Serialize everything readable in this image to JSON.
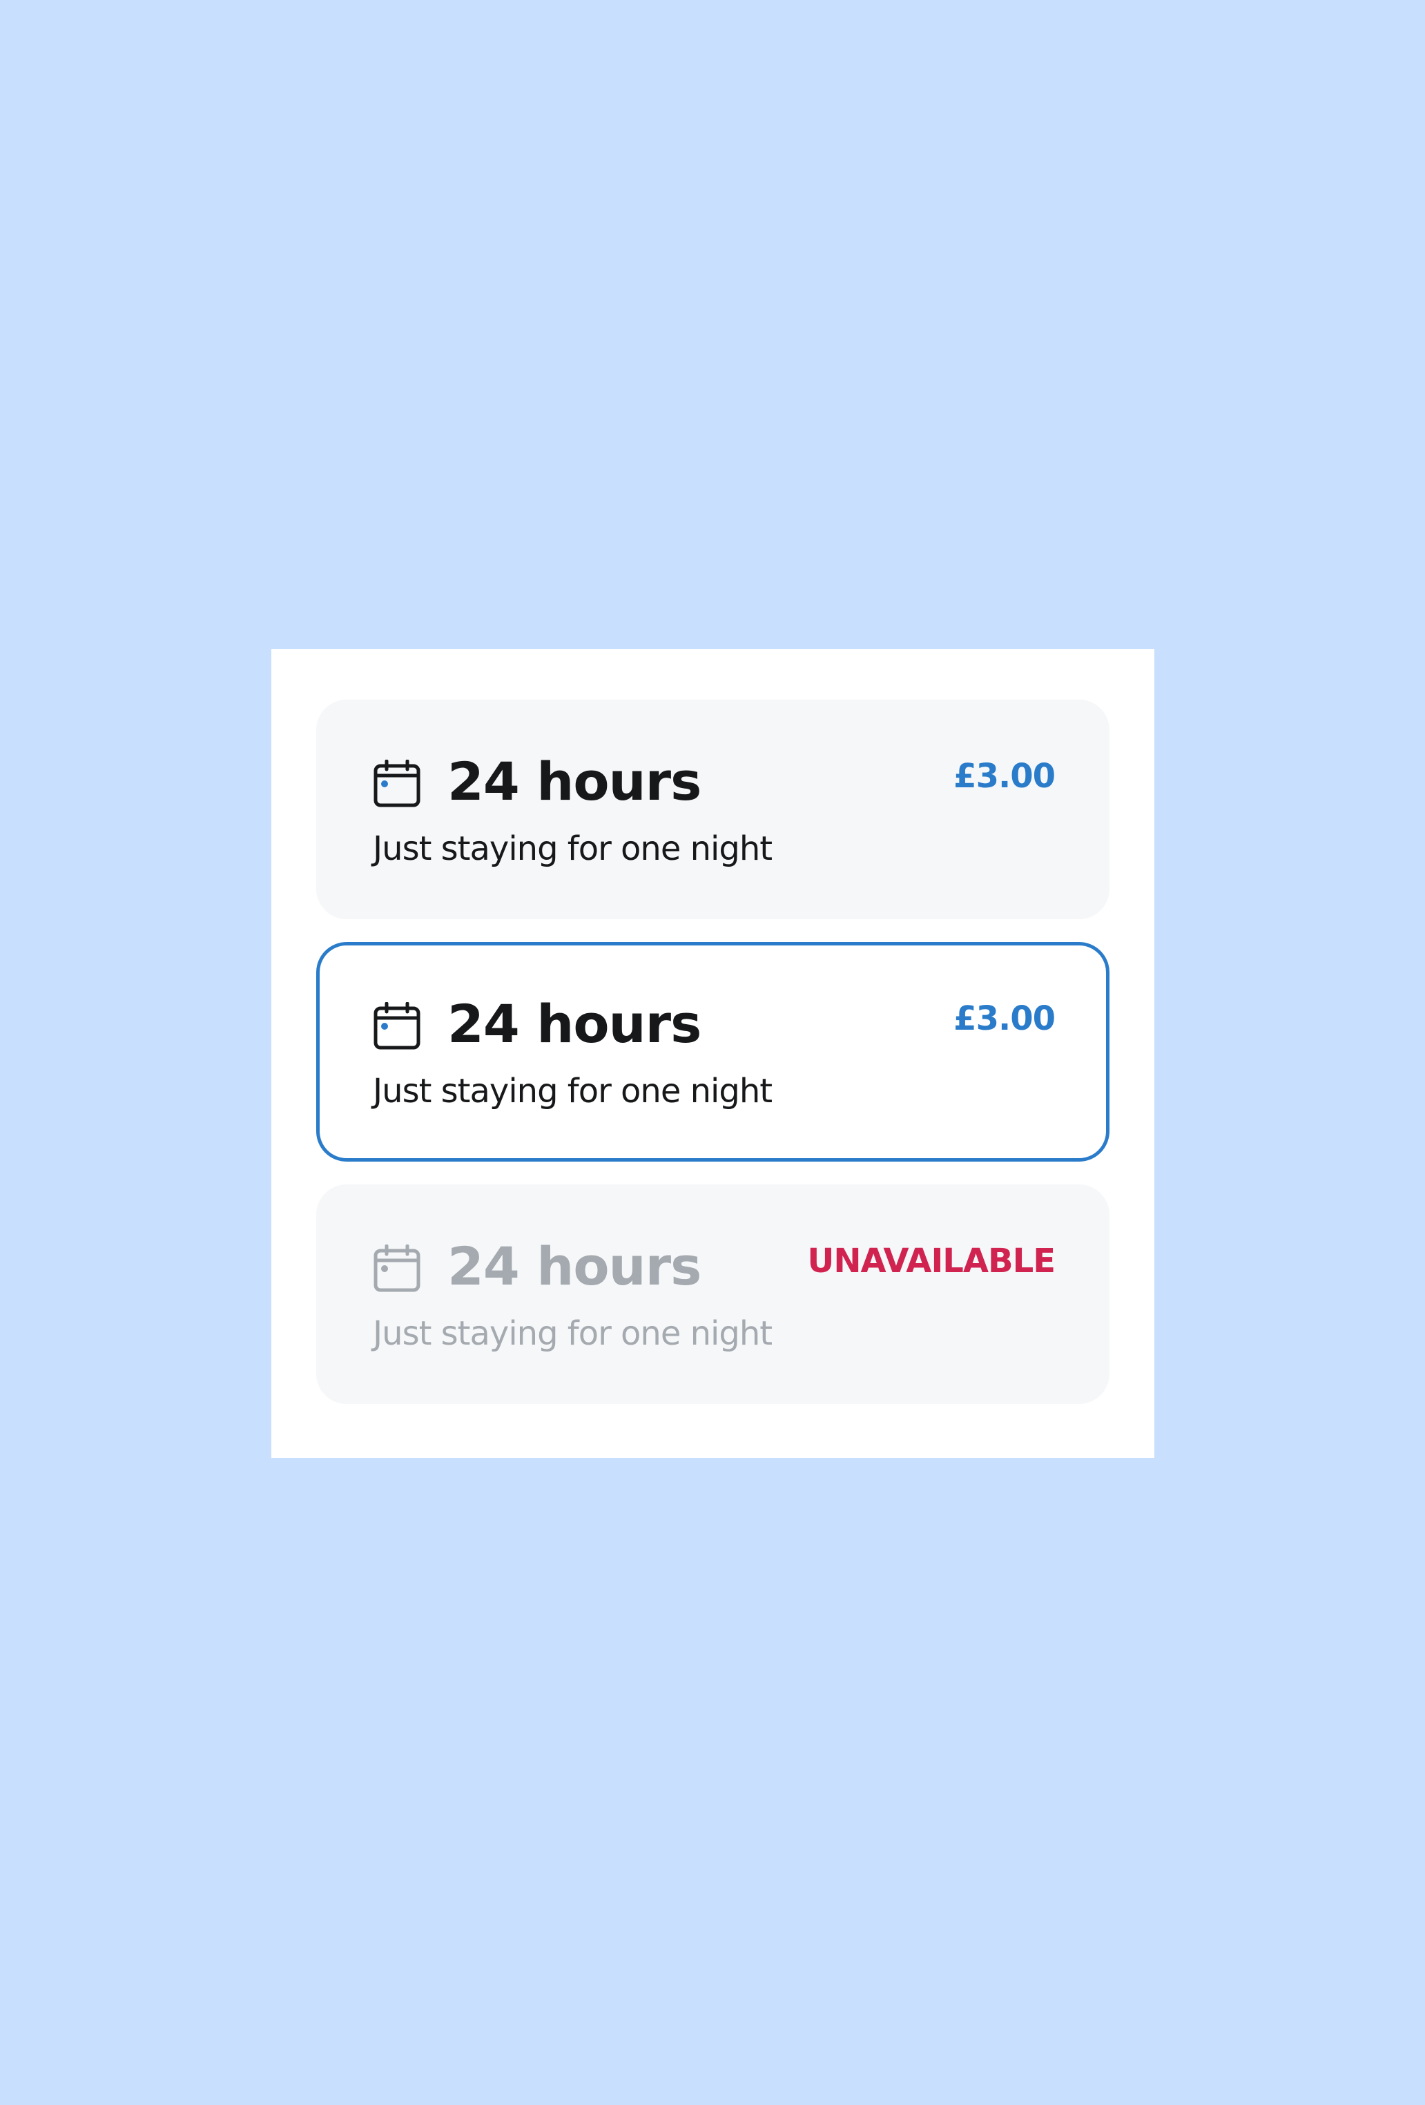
{
  "colors": {
    "background": "#c8e0fe",
    "panel": "#ffffff",
    "card": "#f6f7f9",
    "accent": "#2a7cca",
    "text": "#17181a",
    "muted": "#a4aaaf",
    "error": "#d0234f"
  },
  "options": [
    {
      "state": "default",
      "icon": "calendar-icon",
      "title": "24 hours",
      "subtitle": "Just staying for one night",
      "price": "£3.00"
    },
    {
      "state": "selected",
      "icon": "calendar-icon",
      "title": "24 hours",
      "subtitle": "Just staying for one night",
      "price": "£3.00"
    },
    {
      "state": "disabled",
      "icon": "calendar-icon",
      "title": "24 hours",
      "subtitle": "Just staying for one night",
      "status": "UNAVAILABLE"
    }
  ]
}
